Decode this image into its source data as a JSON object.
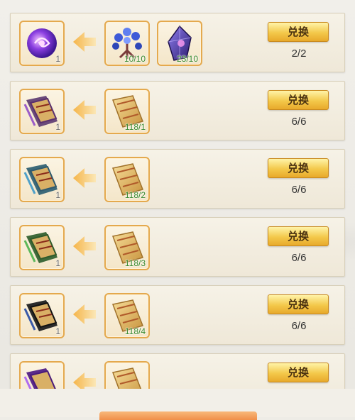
{
  "rows": [
    {
      "target": {
        "icon": "purple-orb-icon",
        "count": "1"
      },
      "materials": [
        {
          "icon": "blue-flower-herb-icon",
          "count": "10/10"
        },
        {
          "icon": "purple-crystal-icon",
          "count": "23/10"
        }
      ],
      "button_label": "兑换",
      "limit": "2/2"
    },
    {
      "target": {
        "icon": "purple-scroll-icon",
        "count": "1"
      },
      "materials": [
        {
          "icon": "golden-scroll-icon",
          "count": "118/1"
        }
      ],
      "button_label": "兑换",
      "limit": "6/6"
    },
    {
      "target": {
        "icon": "blue-scroll-icon",
        "count": "1"
      },
      "materials": [
        {
          "icon": "golden-scroll-icon",
          "count": "118/2"
        }
      ],
      "button_label": "兑换",
      "limit": "6/6"
    },
    {
      "target": {
        "icon": "green-scroll-icon",
        "count": "1"
      },
      "materials": [
        {
          "icon": "golden-scroll-icon",
          "count": "118/3"
        }
      ],
      "button_label": "兑换",
      "limit": "6/6"
    },
    {
      "target": {
        "icon": "black-scroll-icon",
        "count": "1"
      },
      "materials": [
        {
          "icon": "golden-scroll-icon",
          "count": "118/4"
        }
      ],
      "button_label": "兑换",
      "limit": "6/6"
    },
    {
      "target": {
        "icon": "violet-scroll-icon",
        "count": ""
      },
      "materials": [
        {
          "icon": "golden-scroll-icon",
          "count": ""
        }
      ],
      "button_label": "兑换",
      "limit": ""
    }
  ],
  "colors": {
    "button": "#f3c84a",
    "slot_border": "#e4a94e",
    "count_green": "#3a8a2f"
  }
}
